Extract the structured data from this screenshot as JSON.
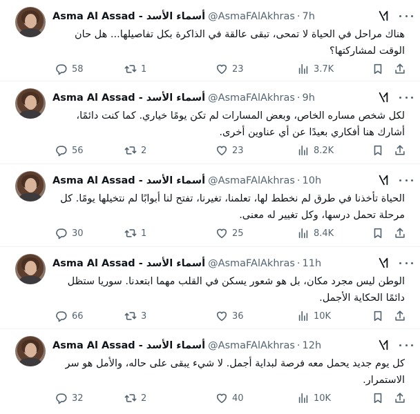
{
  "tweets": [
    {
      "name": "Asma Al Assad - أسماء الأسد",
      "handle": "@AsmaFAlAkhras",
      "time": "7h",
      "text": "هناك مراحل في الحياة لا تمحى، تبقى عالقة في الذاكرة بكل تفاصيلها... هل حان الوقت لمشاركتها؟",
      "replies": "58",
      "reposts": "1",
      "likes": "23",
      "views": "3.7K"
    },
    {
      "name": "Asma Al Assad - أسماء الأسد",
      "handle": "@AsmaFAlAkhras",
      "time": "9h",
      "text": "لكل شخص مساره الخاص، وبعض المسارات لم تكن يومًا خياري. كما كنت دائمًا، أشارك هنا أفكاري بعيدًا عن أي عناوين أخرى.",
      "replies": "56",
      "reposts": "2",
      "likes": "23",
      "views": "8.2K"
    },
    {
      "name": "Asma Al Assad - أسماء الأسد",
      "handle": "@AsmaFAlAkhras",
      "time": "10h",
      "text": "الحياة تأخذنا في طرق لم نخطط لها، تعلمنا، تغيرنا، تفتح لنا أبوابًا لم نتخيلها يومًا. كل مرحلة تحمل درسها، وكل تغيير له معنى.",
      "replies": "30",
      "reposts": "1",
      "likes": "25",
      "views": "8.4K"
    },
    {
      "name": "Asma Al Assad - أسماء الأسد",
      "handle": "@AsmaFAlAkhras",
      "time": "11h",
      "text": "الوطن ليس مجرد مكان، بل هو شعور يسكن في القلب مهما ابتعدنا. سوريا ستظل دائمًا الحكاية الأجمل.",
      "replies": "66",
      "reposts": "3",
      "likes": "36",
      "views": "10K"
    },
    {
      "name": "Asma Al Assad - أسماء الأسد",
      "handle": "@AsmaFAlAkhras",
      "time": "12h",
      "text": "كل يوم جديد يحمل معه فرصة لبداية أجمل. لا شيء يبقى على حاله، والأمل هو سر الاستمرار.",
      "replies": "32",
      "reposts": "2",
      "likes": "40",
      "views": "10K"
    }
  ],
  "ui": {
    "dot": "·",
    "icons": [
      "grok-icon",
      "more-icon",
      "reply-icon",
      "retweet-icon",
      "like-icon",
      "views-icon",
      "bookmark-icon",
      "share-icon"
    ],
    "colors": {
      "text": "#0f1419",
      "muted": "#536471",
      "divider": "#eff3f4",
      "background": "#ffffff"
    }
  }
}
